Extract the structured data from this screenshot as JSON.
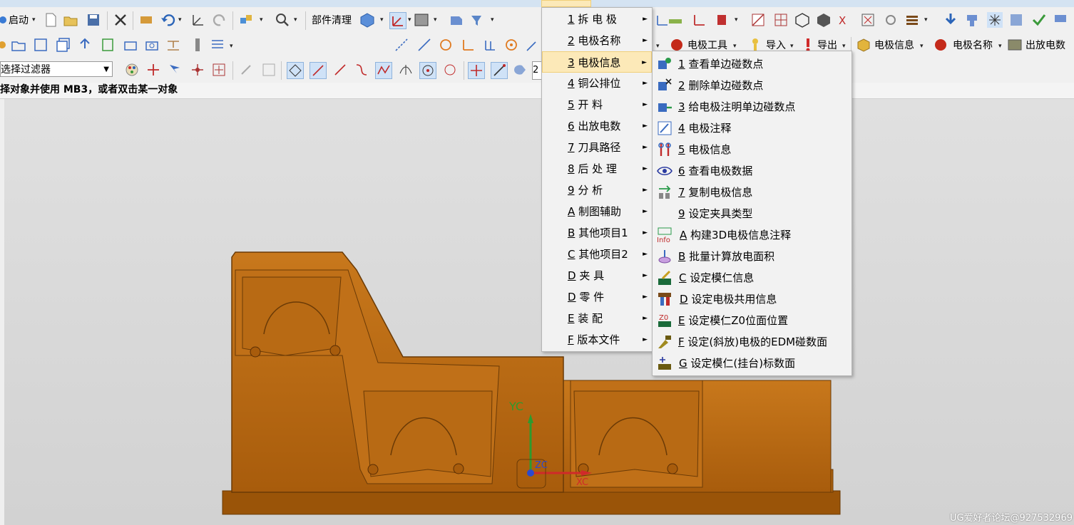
{
  "toolbar": {
    "start_label": "启动",
    "part_cleanup_label": "部件清理",
    "electrode_tools_label": "电极工具",
    "import_label": "导入",
    "export_label": "导出",
    "electrode_info_label": "电极信息",
    "electrode_name_label": "电极名称",
    "discharge_count_label": "出放电数",
    "filter_value": "选择过滤器",
    "zoom_partial": "2"
  },
  "cue_line": "择对象并使用 MB3，或者双击某一对象",
  "menu1": [
    {
      "key": "1",
      "label": " 拆 电 极"
    },
    {
      "key": "2",
      "label": " 电极名称"
    },
    {
      "key": "3",
      "label": " 电极信息"
    },
    {
      "key": "4",
      "label": " 铜公排位"
    },
    {
      "key": "5",
      "label": " 开    料"
    },
    {
      "key": "6",
      "label": " 出放电数"
    },
    {
      "key": "7",
      "label": " 刀具路径"
    },
    {
      "key": "8",
      "label": " 后 处 理"
    },
    {
      "key": "9",
      "label": " 分    析"
    },
    {
      "key": "A",
      "label": " 制图辅助"
    },
    {
      "key": "B",
      "label": " 其他项目1"
    },
    {
      "key": "C",
      "label": " 其他项目2"
    },
    {
      "key": "D",
      "label": " 夹    具"
    },
    {
      "key": "D",
      "label": " 零    件"
    },
    {
      "key": "E",
      "label": " 装    配"
    },
    {
      "key": "F",
      "label": " 版本文件"
    }
  ],
  "menu2": [
    {
      "key": "1",
      "label": " 查看单边碰数点"
    },
    {
      "key": "2",
      "label": " 删除单边碰数点"
    },
    {
      "key": "3",
      "label": " 给电极注明单边碰数点"
    },
    {
      "key": "4",
      "label": " 电极注释"
    },
    {
      "key": "5",
      "label": " 电极信息"
    },
    {
      "key": "6",
      "label": " 查看电极数据"
    },
    {
      "key": "7",
      "label": " 复制电极信息"
    },
    {
      "key": "9",
      "label": " 设定夹具类型"
    },
    {
      "key": "A",
      "label": " 构建3D电极信息注释"
    },
    {
      "key": "B",
      "label": " 批量计算放电面积"
    },
    {
      "key": "C",
      "label": " 设定模仁信息"
    },
    {
      "key": "D",
      "label": " 设定电极共用信息"
    },
    {
      "key": "E",
      "label": " 设定模仁Z0位面位置"
    },
    {
      "key": "F",
      "label": " 设定(斜放)电极的EDM碰数面"
    },
    {
      "key": "G",
      "label": " 设定模仁(挂台)标数面"
    }
  ],
  "icons": {
    "info_icon_text": "Info",
    "z0_icon_text": "Z0"
  },
  "axes": {
    "yc": "YC",
    "zc": "ZC",
    "xc": "XC"
  },
  "watermark": "UG爱好者论坛@927532969"
}
